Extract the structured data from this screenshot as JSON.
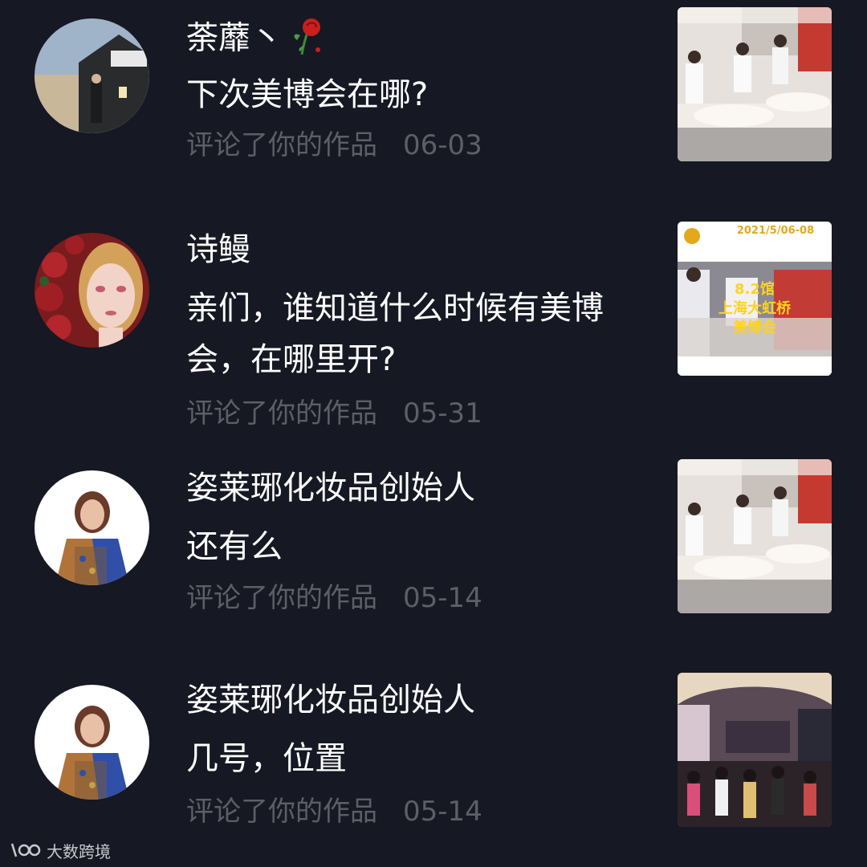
{
  "comments": [
    {
      "username": "荼蘼丶",
      "username_icon": "rose-icon",
      "text": "下次美博会在哪?",
      "action": "评论了你的作品",
      "date": "06-03"
    },
    {
      "username": "诗鳗",
      "text": "亲们，谁知道什么时候有美博会，在哪里开?",
      "action": "评论了你的作品",
      "date": "05-31",
      "thumb_lines": [
        "2021/5/06-08",
        "8.2馆",
        "上海大虹桥",
        "美博会"
      ]
    },
    {
      "username": "姿莱琊化妆品创始人",
      "text": "还有么",
      "action": "评论了你的作品",
      "date": "05-14"
    },
    {
      "username": "姿莱琊化妆品创始人",
      "text": "几号，位置",
      "action": "评论了你的作品",
      "date": "05-14"
    }
  ],
  "watermark": {
    "text": "大数跨境",
    "logo_text": "\\00"
  },
  "colors": {
    "background": "#161823",
    "secondary_text": "#5d5e66",
    "primary_text": "#ffffff"
  }
}
